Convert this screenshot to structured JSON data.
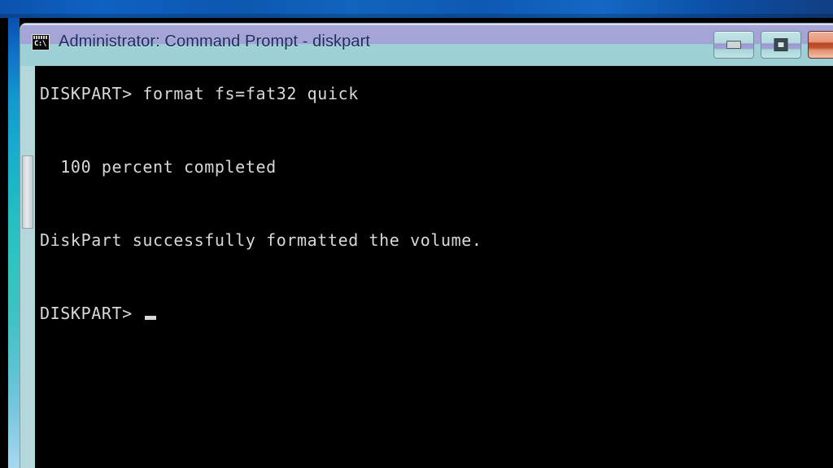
{
  "window": {
    "title": "Administrator: Command Prompt - diskpart",
    "icon": "cmd-console-icon",
    "icon_text": "C:\\",
    "titlebar_top_color": "#a4a3d6",
    "titlebar_bottom_color": "#9cd0d5",
    "frame_color": "#9dd0d5"
  },
  "controls": {
    "minimize_label": "Minimize",
    "restore_label": "Restore",
    "close_label": "Close",
    "close_color": "#b44526"
  },
  "console": {
    "background": "#000000",
    "foreground": "#d8d8d8",
    "lines": [
      "DISKPART> format fs=fat32 quick",
      "",
      "  100 percent completed",
      "",
      "DiskPart successfully formatted the volume.",
      "",
      "DISKPART> "
    ],
    "cursor_visible": true
  },
  "desktop": {
    "top_band_color": "#0d59b4",
    "left_strip_top_color": "#0a4fb0",
    "left_strip_bottom_color": "#a8d8ee"
  }
}
